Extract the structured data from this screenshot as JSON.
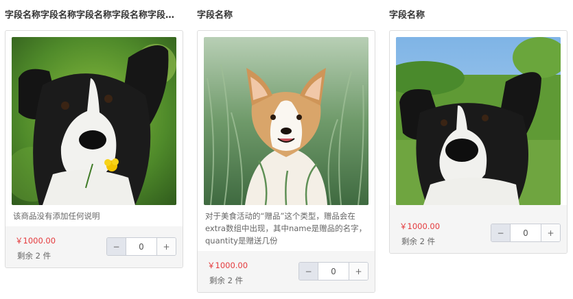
{
  "products": [
    {
      "title": "字段名称字段名称字段名称字段名称字段名称",
      "description": "该商品没有添加任何说明",
      "price": "￥1000.00",
      "stock": "剩余 2 件",
      "quantity": "0",
      "minus_label": "−",
      "plus_label": "+",
      "image": "dog-with-flower-photo"
    },
    {
      "title": "字段名称",
      "description": "对于美食活动的“赠品”这个类型，赠品会在extra数组中出现，其中name是赠品的名字，quantity是赠送几份",
      "price": "￥1000.00",
      "stock": "剩余 2 件",
      "quantity": "0",
      "minus_label": "−",
      "plus_label": "+",
      "image": "corgi-in-grass-photo"
    },
    {
      "title": "字段名称",
      "description": "",
      "price": "￥1000.00",
      "stock": "剩余 2 件",
      "quantity": "0",
      "minus_label": "−",
      "plus_label": "+",
      "image": "dog-closeup-photo"
    }
  ]
}
